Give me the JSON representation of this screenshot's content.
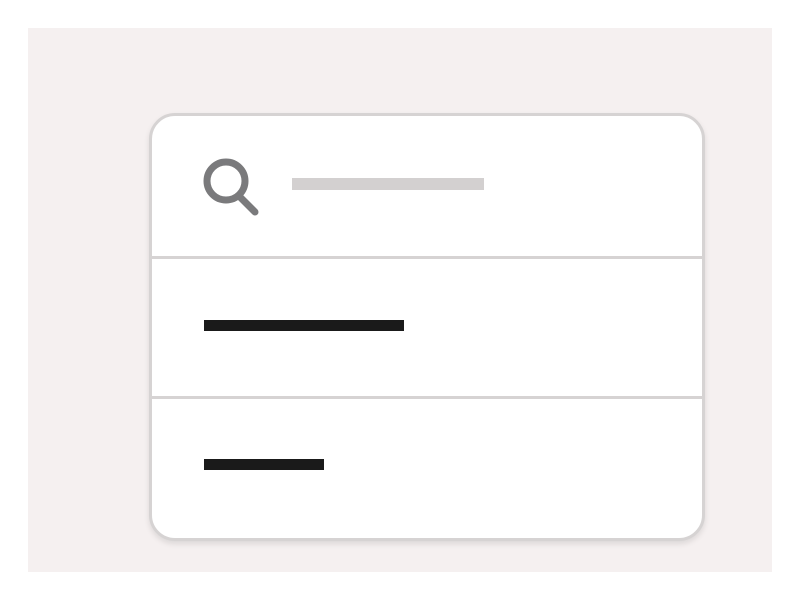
{
  "search": {
    "icon": "search-icon",
    "placeholder": "",
    "value": ""
  },
  "list": {
    "items": [
      {
        "label": ""
      },
      {
        "label": ""
      }
    ]
  },
  "colors": {
    "background": "#f5f0f0",
    "card_border": "#d6d3d3",
    "placeholder_bar": "#d3d0d0",
    "text_bar": "#1a1a1a",
    "icon": "#7a7a7c"
  }
}
